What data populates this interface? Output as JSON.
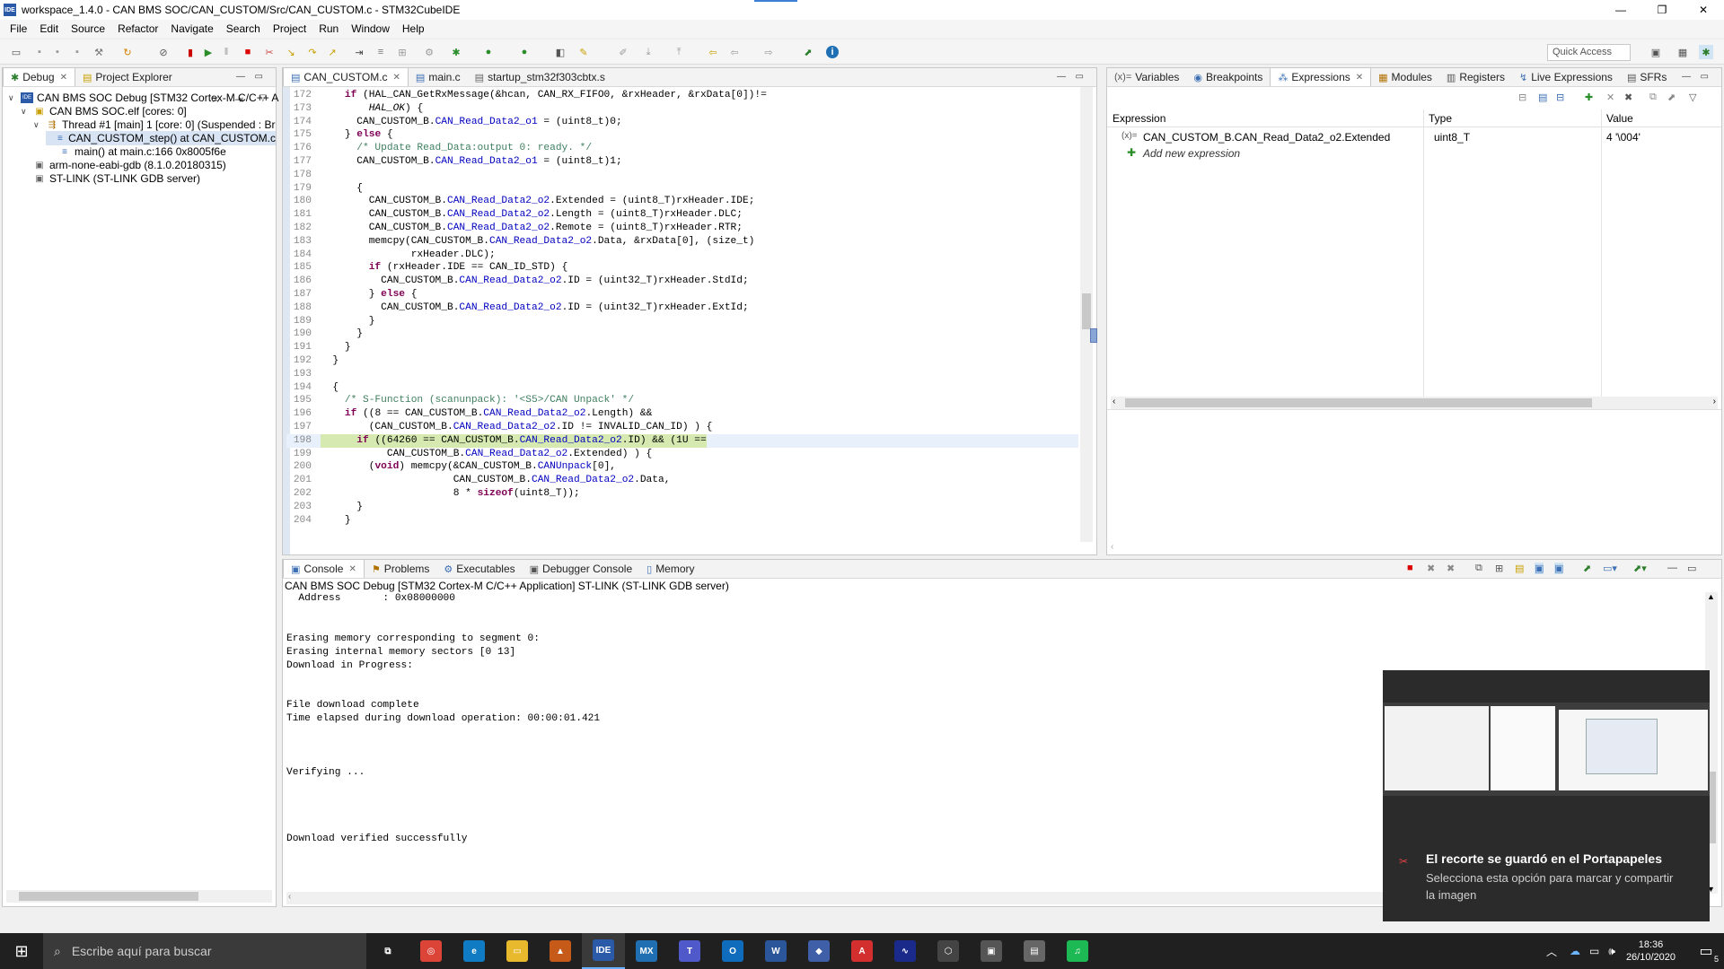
{
  "window": {
    "title": "workspace_1.4.0 - CAN BMS SOC/CAN_CUSTOM/Src/CAN_CUSTOM.c - STM32CubeIDE",
    "app_badge": "IDE",
    "minimize": "—",
    "maximize": "❐",
    "close": "✕"
  },
  "menu": [
    "File",
    "Edit",
    "Source",
    "Refactor",
    "Navigate",
    "Search",
    "Project",
    "Run",
    "Window",
    "Help"
  ],
  "quick_access": {
    "placeholder": "Quick Access"
  },
  "left_panel": {
    "tabs": [
      {
        "label": "Debug",
        "active": true,
        "closable": true
      },
      {
        "label": "Project Explorer",
        "active": false,
        "closable": false
      }
    ],
    "tree": [
      {
        "level": 0,
        "twisty": "∨",
        "label": "CAN BMS SOC Debug [STM32 Cortex-M C/C++ A",
        "icon": "debug-config-icon"
      },
      {
        "level": 1,
        "twisty": "∨",
        "label": "CAN BMS SOC.elf [cores: 0]",
        "icon": "elf-icon"
      },
      {
        "level": 2,
        "twisty": "∨",
        "label": "Thread #1 [main] 1 [core: 0] (Suspended : Br",
        "icon": "thread-icon"
      },
      {
        "level": 3,
        "twisty": "",
        "label": "CAN_CUSTOM_step() at CAN_CUSTOM.c",
        "icon": "stack-frame-icon",
        "selected": true
      },
      {
        "level": 3,
        "twisty": "",
        "label": "main() at main.c:166 0x8005f6e",
        "icon": "stack-frame-icon"
      },
      {
        "level": 1,
        "twisty": "",
        "label": "arm-none-eabi-gdb (8.1.0.20180315)",
        "icon": "gdb-icon"
      },
      {
        "level": 1,
        "twisty": "",
        "label": "ST-LINK (ST-LINK GDB server)",
        "icon": "stlink-icon"
      }
    ]
  },
  "editor": {
    "tabs": [
      {
        "label": "CAN_CUSTOM.c",
        "active": true
      },
      {
        "label": "main.c",
        "active": false
      },
      {
        "label": "startup_stm32f303cbtx.s",
        "active": false
      }
    ],
    "lines": [
      {
        "n": "172",
        "t": "    if (HAL_CAN_GetRxMessage(&hcan, CAN_RX_FIFO0, &rxHeader, &rxData[0])!="
      },
      {
        "n": "173",
        "t": "        HAL_OK) {"
      },
      {
        "n": "174",
        "t": "      CAN_CUSTOM_B.CAN_Read_Data2_o1 = (uint8_t)0;"
      },
      {
        "n": "175",
        "t": "    } else {"
      },
      {
        "n": "176",
        "t": "      /* Update Read_Data:output 0: ready. */"
      },
      {
        "n": "177",
        "t": "      CAN_CUSTOM_B.CAN_Read_Data2_o1 = (uint8_t)1;"
      },
      {
        "n": "178",
        "t": ""
      },
      {
        "n": "179",
        "t": "      {"
      },
      {
        "n": "180",
        "t": "        CAN_CUSTOM_B.CAN_Read_Data2_o2.Extended = (uint8_T)rxHeader.IDE;"
      },
      {
        "n": "181",
        "t": "        CAN_CUSTOM_B.CAN_Read_Data2_o2.Length = (uint8_T)rxHeader.DLC;"
      },
      {
        "n": "182",
        "t": "        CAN_CUSTOM_B.CAN_Read_Data2_o2.Remote = (uint8_T)rxHeader.RTR;"
      },
      {
        "n": "183",
        "t": "        memcpy(CAN_CUSTOM_B.CAN_Read_Data2_o2.Data, &rxData[0], (size_t)"
      },
      {
        "n": "184",
        "t": "               rxHeader.DLC);"
      },
      {
        "n": "185",
        "t": "        if (rxHeader.IDE == CAN_ID_STD) {"
      },
      {
        "n": "186",
        "t": "          CAN_CUSTOM_B.CAN_Read_Data2_o2.ID = (uint32_T)rxHeader.StdId;"
      },
      {
        "n": "187",
        "t": "        } else {"
      },
      {
        "n": "188",
        "t": "          CAN_CUSTOM_B.CAN_Read_Data2_o2.ID = (uint32_T)rxHeader.ExtId;"
      },
      {
        "n": "189",
        "t": "        }"
      },
      {
        "n": "190",
        "t": "      }"
      },
      {
        "n": "191",
        "t": "    }"
      },
      {
        "n": "192",
        "t": "  }"
      },
      {
        "n": "193",
        "t": ""
      },
      {
        "n": "194",
        "t": "  {"
      },
      {
        "n": "195",
        "t": "    /* S-Function (scanunpack): '<S5>/CAN Unpack' */"
      },
      {
        "n": "196",
        "t": "    if ((8 == CAN_CUSTOM_B.CAN_Read_Data2_o2.Length) &&"
      },
      {
        "n": "197",
        "t": "        (CAN_CUSTOM_B.CAN_Read_Data2_o2.ID != INVALID_CAN_ID) ) {"
      },
      {
        "n": "198",
        "t": "      if ((64260 == CAN_CUSTOM_B.CAN_Read_Data2_o2.ID) && (1U ==",
        "hl": true
      },
      {
        "n": "199",
        "t": "           CAN_CUSTOM_B.CAN_Read_Data2_o2.Extended) ) {"
      },
      {
        "n": "200",
        "t": "        (void) memcpy(&CAN_CUSTOM_B.CANUnpack[0],"
      },
      {
        "n": "201",
        "t": "                      CAN_CUSTOM_B.CAN_Read_Data2_o2.Data,"
      },
      {
        "n": "202",
        "t": "                      8 * sizeof(uint8_T));"
      },
      {
        "n": "203",
        "t": "      }"
      },
      {
        "n": "204",
        "t": "    }"
      }
    ]
  },
  "right_panel": {
    "tabs": [
      {
        "label": "Variables",
        "icon": "(x)=",
        "active": false
      },
      {
        "label": "Breakpoints",
        "icon": "◉",
        "active": false
      },
      {
        "label": "Expressions",
        "icon": "⁂",
        "active": true
      },
      {
        "label": "Modules",
        "icon": "▦",
        "active": false
      },
      {
        "label": "Registers",
        "icon": "▥",
        "active": false
      },
      {
        "label": "Live Expressions",
        "icon": "↯",
        "active": false
      },
      {
        "label": "SFRs",
        "icon": "▤",
        "active": false
      }
    ],
    "columns": [
      "Expression",
      "Type",
      "Value"
    ],
    "rows": [
      {
        "expression": "CAN_CUSTOM_B.CAN_Read_Data2_o2.Extended",
        "type": "uint8_T",
        "value": "4 '\\004'"
      }
    ],
    "add_label": "Add new expression"
  },
  "console": {
    "tabs": [
      {
        "label": "Console",
        "active": true
      },
      {
        "label": "Problems",
        "active": false
      },
      {
        "label": "Executables",
        "active": false
      },
      {
        "label": "Debugger Console",
        "active": false
      },
      {
        "label": "Memory",
        "active": false
      }
    ],
    "header": "CAN BMS SOC Debug [STM32 Cortex-M C/C++ Application] ST-LINK (ST-LINK GDB server)",
    "text": "  Address       : 0x08000000\n\n\nErasing memory corresponding to segment 0:\nErasing internal memory sectors [0 13]\nDownload in Progress:\n\n\nFile download complete\nTime elapsed during download operation: 00:00:01.421\n\n\n\nVerifying ...\n\n\n\n\nDownload verified successfully"
  },
  "toast": {
    "title": "El recorte se guardó en el Portapapeles",
    "body": "Selecciona esta opción para marcar y compartir la imagen"
  },
  "taskbar": {
    "search_placeholder": "Escribe aquí para buscar",
    "apps": [
      {
        "name": "task-view",
        "label": "⧉",
        "color": "#202020"
      },
      {
        "name": "chrome",
        "label": "◎",
        "color": "#db4437"
      },
      {
        "name": "edge",
        "label": "e",
        "color": "#0f7bc2"
      },
      {
        "name": "file-explorer",
        "label": "▭",
        "color": "#e8b92c"
      },
      {
        "name": "matlab",
        "label": "▲",
        "color": "#c65a19"
      },
      {
        "name": "stm32cubeide",
        "label": "IDE",
        "color": "#2b5ba8"
      },
      {
        "name": "stm32cubemx",
        "label": "MX",
        "color": "#1f6fb2"
      },
      {
        "name": "teams",
        "label": "T",
        "color": "#5059c9"
      },
      {
        "name": "outlook",
        "label": "O",
        "color": "#0f6cbd"
      },
      {
        "name": "word",
        "label": "W",
        "color": "#2b579a"
      },
      {
        "name": "app-blue",
        "label": "◆",
        "color": "#3f5fa8"
      },
      {
        "name": "acrobat",
        "label": "A",
        "color": "#d32f2f"
      },
      {
        "name": "app-navy",
        "label": "∿",
        "color": "#1a2a8a"
      },
      {
        "name": "app-cube",
        "label": "⬡",
        "color": "#444"
      },
      {
        "name": "app-gray",
        "label": "▣",
        "color": "#555"
      },
      {
        "name": "app-folder",
        "label": "▤",
        "color": "#666"
      },
      {
        "name": "spotify",
        "label": "♫",
        "color": "#1db954"
      }
    ],
    "time": "18:36",
    "date": "26/10/2020",
    "notification_count": "5"
  }
}
